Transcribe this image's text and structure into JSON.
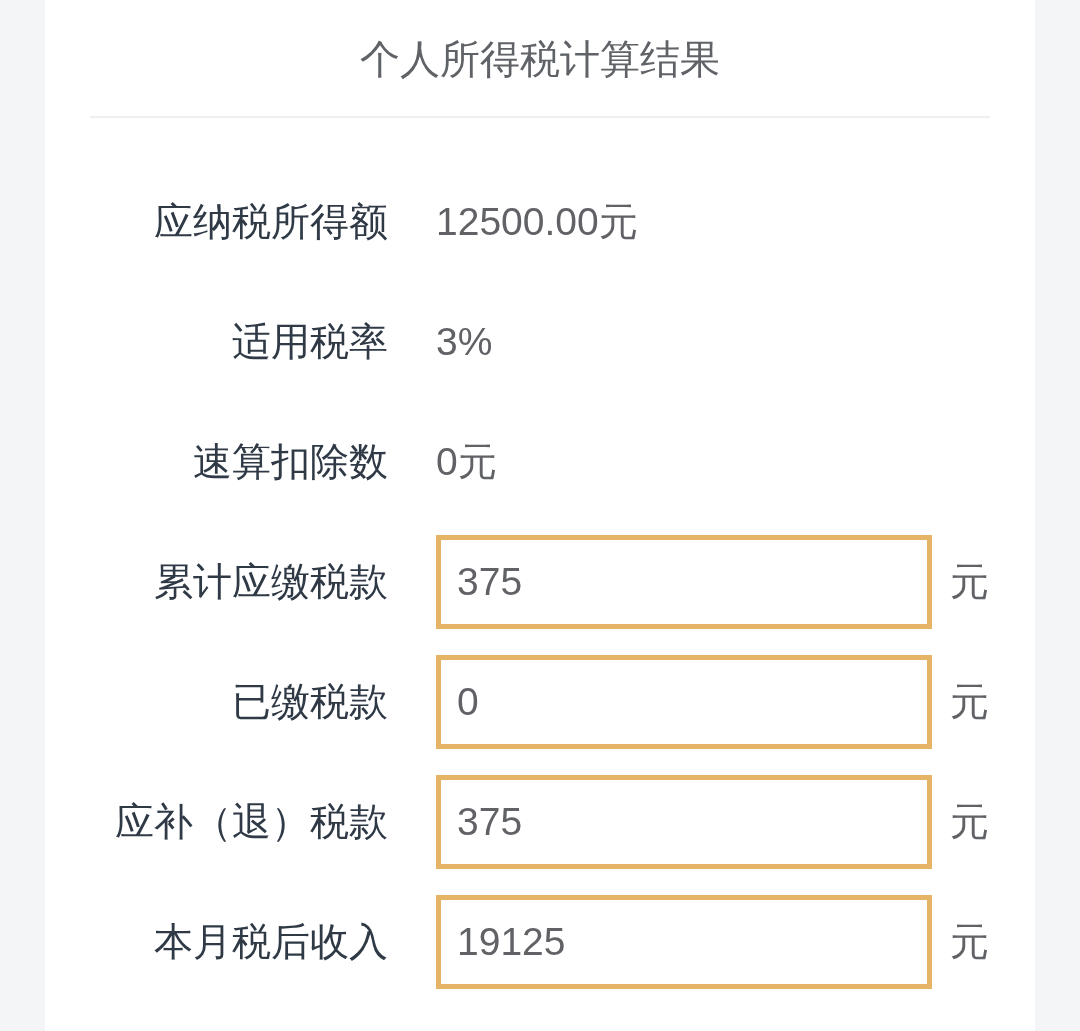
{
  "title": "个人所得税计算结果",
  "rows": [
    {
      "kind": "text",
      "label": "应纳税所得额",
      "value": "12500.00元"
    },
    {
      "kind": "text",
      "label": "适用税率",
      "value": "3%"
    },
    {
      "kind": "text",
      "label": "速算扣除数",
      "value": "0元"
    },
    {
      "kind": "field",
      "label": "累计应缴税款",
      "value": "375",
      "unit": "元"
    },
    {
      "kind": "field",
      "label": "已缴税款",
      "value": "0",
      "unit": "元"
    },
    {
      "kind": "field",
      "label": "应补（退）税款",
      "value": "375",
      "unit": "元"
    },
    {
      "kind": "field",
      "label": "本月税后收入",
      "value": "19125",
      "unit": "元"
    }
  ]
}
